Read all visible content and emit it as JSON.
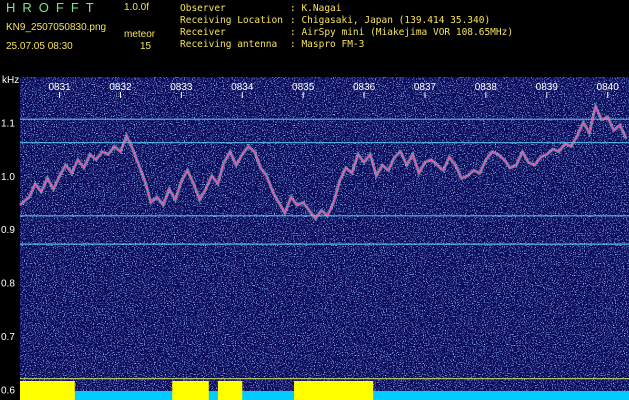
{
  "header": {
    "brand": "HROFFT",
    "version": "1.0.0f",
    "file_name": "KN9_2507050830.png",
    "timestamp": "25.07.05 08:30",
    "meteor_label": "meteor",
    "meteor_count": "15",
    "observer_label": "Observer",
    "observer_value": ": K.Nagai",
    "location_label": "Receiving Location",
    "location_value": ": Chigasaki, Japan (139.414 35.340)",
    "receiver_label": "Receiver",
    "receiver_value": ": AirSpy mini (Miakejima VOR 108.65MHz)",
    "antenna_label": "Receiving antenna",
    "antenna_value": ": Maspro FM-3"
  },
  "colors": {
    "background": "#000000",
    "noise_bg": "#0a0a5a",
    "header_text": "#f4e35a",
    "brand_text": "#7fe38a",
    "axis_text": "#ffffff",
    "carrier_line": "#5fd6ff",
    "reflection_trace": "#ff4fb8",
    "meteor_bar": "#ffff00",
    "baseline": "#00ccff"
  },
  "chart_data": {
    "type": "heatmap",
    "ylabel": "kHz",
    "y_ticks": [
      "1.1",
      "1.0",
      "0.9",
      "0.8",
      "0.7",
      "0.6"
    ],
    "y_values": [
      1.1,
      1.0,
      0.9,
      0.8,
      0.7,
      0.6
    ],
    "ylim": [
      0.58,
      1.185
    ],
    "x_ticks": [
      "0831",
      "0832",
      "0833",
      "0834",
      "0835",
      "0836",
      "0837",
      "0838",
      "0839",
      "0840"
    ],
    "x_values": [
      1,
      2,
      3,
      4,
      5,
      6,
      7,
      8,
      9,
      10
    ],
    "xlim": [
      0.35,
      10.35
    ],
    "carrier_lines_khz": [
      1.106,
      1.062,
      0.925,
      0.872,
      0.62
    ],
    "reflection_trace": {
      "minutes": [
        0.35,
        0.5,
        0.6,
        0.7,
        0.8,
        0.9,
        1.0,
        1.1,
        1.2,
        1.3,
        1.4,
        1.5,
        1.6,
        1.7,
        1.8,
        1.9,
        2.0,
        2.1,
        2.2,
        2.3,
        2.4,
        2.5,
        2.6,
        2.7,
        2.8,
        2.9,
        3.0,
        3.1,
        3.2,
        3.3,
        3.4,
        3.5,
        3.6,
        3.7,
        3.8,
        3.9,
        4.0,
        4.1,
        4.2,
        4.3,
        4.4,
        4.5,
        4.6,
        4.7,
        4.8,
        4.9,
        5.0,
        5.1,
        5.2,
        5.3,
        5.4,
        5.5,
        5.6,
        5.7,
        5.8,
        5.9,
        6.0,
        6.1,
        6.2,
        6.3,
        6.4,
        6.5,
        6.6,
        6.7,
        6.8,
        6.9,
        7.0,
        7.1,
        7.2,
        7.3,
        7.4,
        7.5,
        7.6,
        7.7,
        7.8,
        7.9,
        8.0,
        8.1,
        8.2,
        8.3,
        8.4,
        8.5,
        8.6,
        8.7,
        8.8,
        8.9,
        9.0,
        9.1,
        9.2,
        9.3,
        9.4,
        9.5,
        9.6,
        9.7,
        9.8,
        9.9,
        10.0,
        10.1,
        10.2,
        10.3
      ],
      "khz": [
        0.945,
        0.96,
        0.985,
        0.97,
        0.995,
        0.975,
        1.0,
        1.02,
        1.005,
        1.03,
        1.015,
        1.04,
        1.03,
        1.045,
        1.04,
        1.055,
        1.045,
        1.075,
        1.05,
        1.02,
        0.99,
        0.95,
        0.96,
        0.945,
        0.975,
        0.955,
        0.99,
        1.01,
        0.985,
        0.955,
        0.975,
        1.0,
        0.985,
        1.025,
        1.045,
        1.02,
        1.04,
        1.055,
        1.045,
        1.015,
        1.0,
        0.97,
        0.95,
        0.93,
        0.96,
        0.945,
        0.95,
        0.935,
        0.92,
        0.935,
        0.925,
        0.95,
        0.99,
        1.015,
        1.005,
        1.04,
        1.025,
        1.04,
        1.0,
        1.02,
        1.01,
        1.035,
        1.045,
        1.02,
        1.04,
        1.005,
        1.025,
        1.03,
        1.02,
        1.01,
        1.035,
        1.02,
        0.995,
        1.0,
        1.01,
        1.005,
        1.03,
        1.045,
        1.04,
        1.03,
        1.015,
        1.02,
        1.045,
        1.025,
        1.02,
        1.035,
        1.04,
        1.05,
        1.045,
        1.06,
        1.055,
        1.075,
        1.1,
        1.08,
        1.13,
        1.105,
        1.11,
        1.085,
        1.095,
        1.07
      ]
    },
    "meteor_bars": [
      [
        0.35,
        1.25
      ],
      [
        2.85,
        3.45
      ],
      [
        3.6,
        4.0
      ],
      [
        4.85,
        6.15
      ]
    ]
  }
}
